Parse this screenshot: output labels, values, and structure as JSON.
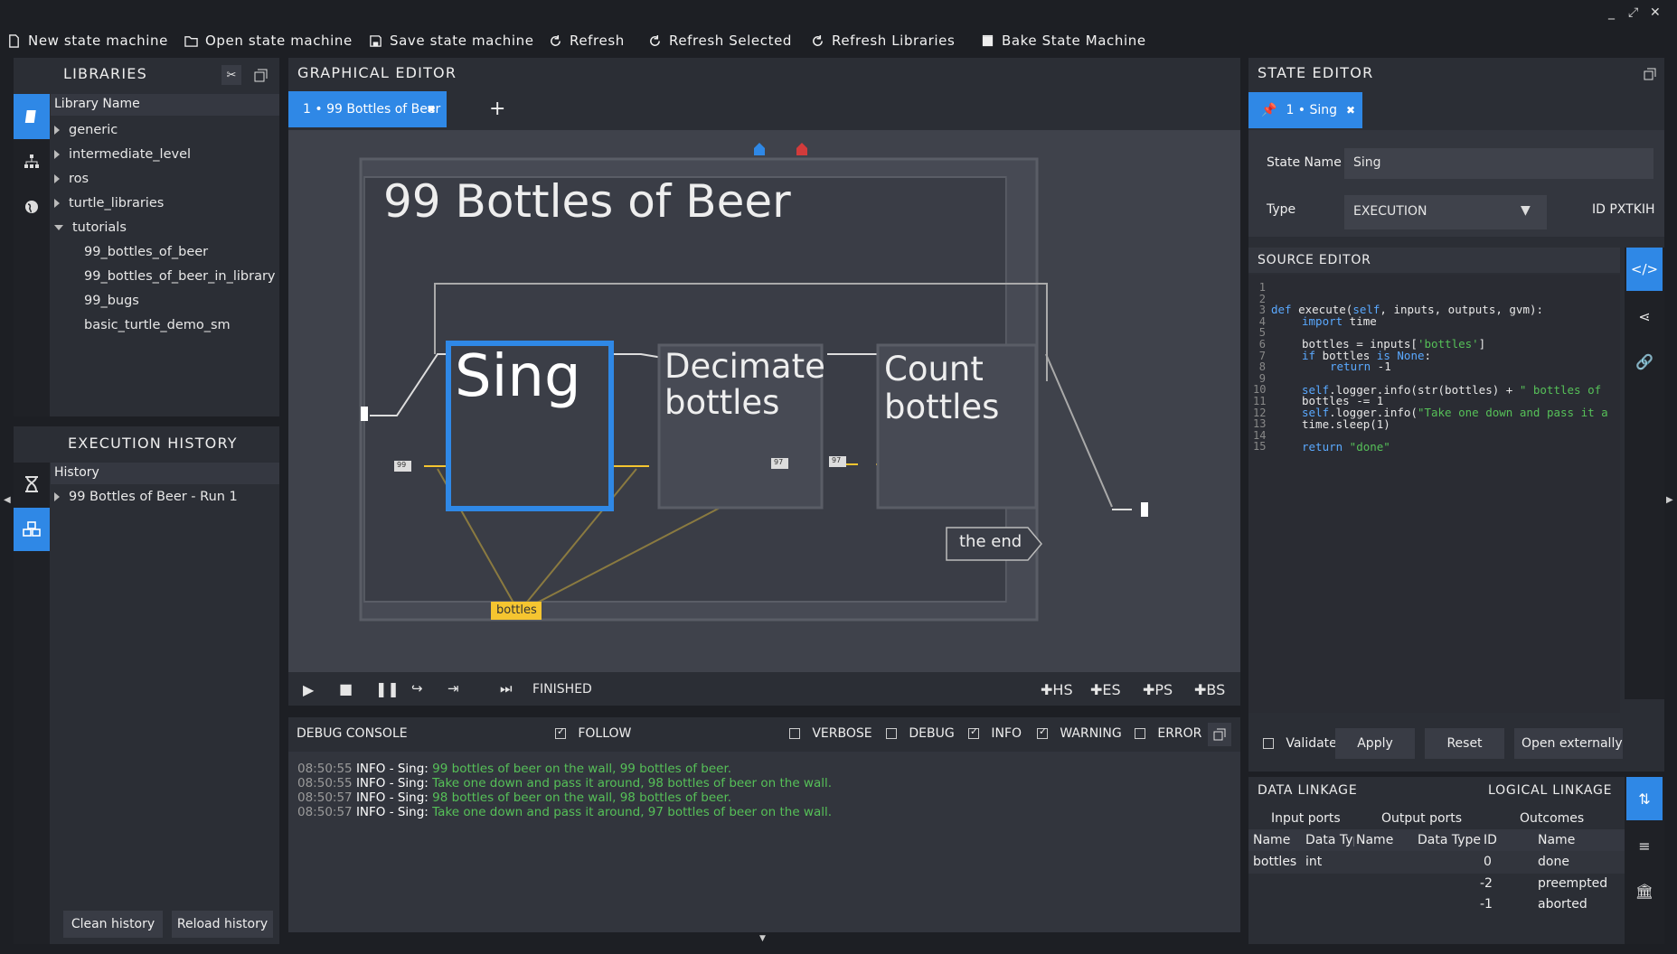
{
  "toolbar": {
    "new": "New state machine",
    "open": "Open state machine",
    "save": "Save state machine",
    "refresh": "Refresh",
    "refresh_selected": "Refresh Selected",
    "refresh_libraries": "Refresh Libraries",
    "bake": "Bake State Machine"
  },
  "libraries": {
    "title": "LIBRARIES",
    "header": "Library Name",
    "items": [
      "generic",
      "intermediate_level",
      "ros",
      "turtle_libraries",
      "tutorials"
    ],
    "children": [
      "99_bottles_of_beer",
      "99_bottles_of_beer_in_library",
      "99_bugs",
      "basic_turtle_demo_sm"
    ]
  },
  "history": {
    "title": "EXECUTION HISTORY",
    "header": "History",
    "item": "99 Bottles of Beer - Run 1",
    "clean": "Clean history",
    "reload": "Reload history"
  },
  "graph": {
    "title": "GRAPHICAL EDITOR",
    "tab": "1 • 99 Bottles of Beer",
    "sm_title": "99 Bottles of Beer",
    "state_sing": "Sing",
    "state_decimate_1": "Decimate",
    "state_decimate_2": "bottles",
    "state_count_1": "Count",
    "state_count_2": "bottles",
    "state_end": "the end",
    "port_bottles": "bottles",
    "val_99": "99",
    "val_97a": "97",
    "val_97b": "97",
    "status": "FINISHED",
    "hs": "HS",
    "es": "ES",
    "ps": "PS",
    "bs": "BS"
  },
  "console": {
    "title": "DEBUG CONSOLE",
    "follow": "FOLLOW",
    "verbose": "VERBOSE",
    "debug": "DEBUG",
    "info": "INFO",
    "warning": "WARNING",
    "error": "ERROR",
    "logs": [
      {
        "time": "08:50:55",
        "src": "INFO - Sing:",
        "msg": "99 bottles of beer on the wall, 99 bottles of beer."
      },
      {
        "time": "08:50:55",
        "src": "INFO - Sing:",
        "msg": "Take one down and pass it around, 98 bottles of beer on the wall."
      },
      {
        "time": "08:50:57",
        "src": "INFO - Sing:",
        "msg": "98 bottles of beer on the wall, 98 bottles of beer."
      },
      {
        "time": "08:50:57",
        "src": "INFO - Sing:",
        "msg": "Take one down and pass it around, 97 bottles of beer on the wall."
      }
    ]
  },
  "state_editor": {
    "title": "STATE EDITOR",
    "tab": "1 • Sing",
    "name_label": "State Name",
    "name_value": "Sing",
    "type_label": "Type",
    "type_value": "EXECUTION",
    "id": "ID PXTKIH",
    "source_title": "SOURCE EDITOR",
    "validate": "Validate",
    "apply": "Apply",
    "reset": "Reset",
    "open_ext": "Open externally"
  },
  "linkage": {
    "data_title": "DATA LINKAGE",
    "logical_title": "LOGICAL LINKAGE",
    "input_ports": "Input ports",
    "output_ports": "Output ports",
    "outcomes": "Outcomes",
    "col_name": "Name",
    "col_type": "Data Type",
    "col_name2": "Name",
    "col_type2": "Data Type",
    "col_id": "ID",
    "col_name3": "Name",
    "in_name": "bottles",
    "in_type": "int",
    "outcome_rows": [
      {
        "id": "0",
        "name": "done"
      },
      {
        "id": "-2",
        "name": "preempted"
      },
      {
        "id": "-1",
        "name": "aborted"
      }
    ]
  },
  "colors": {
    "accent": "#2f88e6",
    "log_message": "#56c058",
    "port_yellow": "#f5c530"
  }
}
